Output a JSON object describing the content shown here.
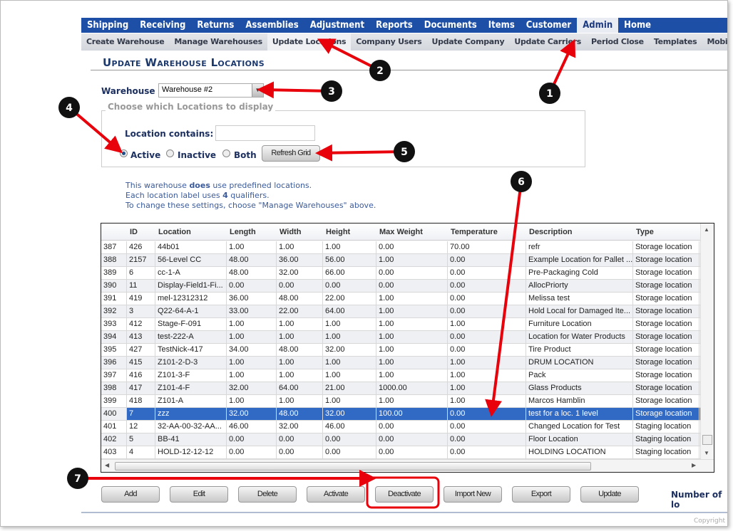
{
  "nav": {
    "items": [
      "Shipping",
      "Receiving",
      "Returns",
      "Assemblies",
      "Adjustment",
      "Reports",
      "Documents",
      "Items",
      "Customer",
      "Admin",
      "Home"
    ],
    "active": "Admin"
  },
  "subnav": {
    "items": [
      "Create Warehouse",
      "Manage Warehouses",
      "Update Locations",
      "Company Users",
      "Update Company",
      "Update Carriers",
      "Period Close",
      "Templates",
      "Mobile"
    ],
    "active": "Update Locations"
  },
  "page_title": "Update Warehouse Locations",
  "warehouse": {
    "label": "Warehouse",
    "value": "Warehouse #2"
  },
  "filter": {
    "legend": "Choose which Locations to display",
    "location_label": "Location contains:",
    "location_value": "",
    "radios": [
      "Active",
      "Inactive",
      "Both"
    ],
    "selected": "Active",
    "refresh_label": "Refresh Grid"
  },
  "info": {
    "line1_pre": "This warehouse ",
    "line1_bold": "does",
    "line1_post": " use predefined locations.",
    "line2_pre": "Each location label uses ",
    "line2_bold": "4",
    "line2_post": " qualifiers.",
    "line3": "To change these settings, choose \"Manage Warehouses\" above."
  },
  "grid": {
    "columns": [
      "",
      "ID",
      "Location",
      "Length",
      "Width",
      "Height",
      "Max Weight",
      "Temperature",
      "Description",
      "Type"
    ],
    "rows": [
      [
        "387",
        "426",
        "44b01",
        "1.00",
        "1.00",
        "1.00",
        "0.00",
        "70.00",
        "refr",
        "Storage location"
      ],
      [
        "388",
        "2157",
        "56-Level CC",
        "48.00",
        "36.00",
        "56.00",
        "1.00",
        "0.00",
        "Example Location for Pallet ...",
        "Storage location"
      ],
      [
        "389",
        "6",
        "cc-1-A",
        "48.00",
        "32.00",
        "66.00",
        "0.00",
        "0.00",
        "Pre-Packaging Cold",
        "Storage location"
      ],
      [
        "390",
        "11",
        "Display-Field1-Fi...",
        "0.00",
        "0.00",
        "0.00",
        "0.00",
        "0.00",
        "AllocPriorty",
        "Storage location"
      ],
      [
        "391",
        "419",
        "mel-12312312",
        "36.00",
        "48.00",
        "22.00",
        "1.00",
        "0.00",
        "Melissa test",
        "Storage location"
      ],
      [
        "392",
        "3",
        "Q22-64-A-1",
        "33.00",
        "22.00",
        "64.00",
        "1.00",
        "0.00",
        "Hold Local for Damaged Ite...",
        "Storage location"
      ],
      [
        "393",
        "412",
        "Stage-F-091",
        "1.00",
        "1.00",
        "1.00",
        "1.00",
        "1.00",
        "Furniture Location",
        "Storage location"
      ],
      [
        "394",
        "413",
        "test-222-A",
        "1.00",
        "1.00",
        "1.00",
        "1.00",
        "0.00",
        "Location for Water Products",
        "Storage location"
      ],
      [
        "395",
        "427",
        "TestNick-417",
        "34.00",
        "48.00",
        "32.00",
        "1.00",
        "0.00",
        "Tire Product",
        "Storage location"
      ],
      [
        "396",
        "415",
        "Z101-2-D-3",
        "1.00",
        "1.00",
        "1.00",
        "1.00",
        "1.00",
        "DRUM LOCATION",
        "Storage location"
      ],
      [
        "397",
        "416",
        "Z101-3-F",
        "1.00",
        "1.00",
        "1.00",
        "1.00",
        "1.00",
        "Pack",
        "Storage location"
      ],
      [
        "398",
        "417",
        "Z101-4-F",
        "32.00",
        "64.00",
        "21.00",
        "1000.00",
        "1.00",
        "Glass Products",
        "Storage location"
      ],
      [
        "399",
        "418",
        "Z101-A",
        "1.00",
        "1.00",
        "1.00",
        "1.00",
        "1.00",
        "Marcos Hamblin",
        "Storage location"
      ],
      [
        "400",
        "7",
        "zzz",
        "32.00",
        "48.00",
        "32.00",
        "100.00",
        "0.00",
        "test for a loc. 1 level",
        "Storage location"
      ],
      [
        "401",
        "12",
        "32-AA-00-32-AA...",
        "46.00",
        "32.00",
        "46.00",
        "0.00",
        "0.00",
        "Changed Location for Test",
        "Staging location"
      ],
      [
        "402",
        "5",
        "BB-41",
        "0.00",
        "0.00",
        "0.00",
        "0.00",
        "0.00",
        "Floor Location",
        "Staging location"
      ],
      [
        "403",
        "4",
        "HOLD-12-12-12",
        "0.00",
        "0.00",
        "0.00",
        "0.00",
        "0.00",
        "HOLDING LOCATION",
        "Staging location"
      ]
    ],
    "selected_row": "400"
  },
  "actions": [
    "Add",
    "Edit",
    "Delete",
    "Activate",
    "Deactivate",
    "Import New",
    "Export",
    "Update"
  ],
  "count_label": "Number of lo",
  "copyright": "Copyright",
  "annotations": [
    "1",
    "2",
    "3",
    "4",
    "5",
    "6",
    "7"
  ],
  "colors": {
    "nav": "#1d4fa6",
    "selection": "#316ac5",
    "callout": "#e8000b"
  }
}
